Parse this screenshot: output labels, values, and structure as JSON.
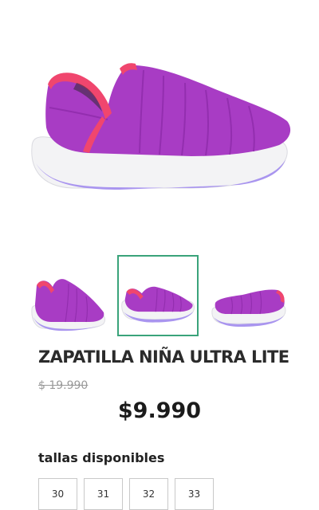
{
  "product": {
    "title": "ZAPATILLA NIÑA ULTRA LITE",
    "old_price": "$ 19.990",
    "price": "$9.990"
  },
  "gallery": {
    "selected_index": 1,
    "thumbnails": [
      "shoe-side-view",
      "shoe-angled-view",
      "shoe-front-view"
    ]
  },
  "colors": {
    "shoe_body": "#a83cc4",
    "shoe_trim": "#f0466e",
    "sole": "#f4f4f6",
    "sole_accent": "#9f8cf0",
    "selected_border": "#3aa37a"
  },
  "sizes": {
    "title": "tallas disponibles",
    "options": [
      "30",
      "31",
      "32",
      "33"
    ]
  }
}
